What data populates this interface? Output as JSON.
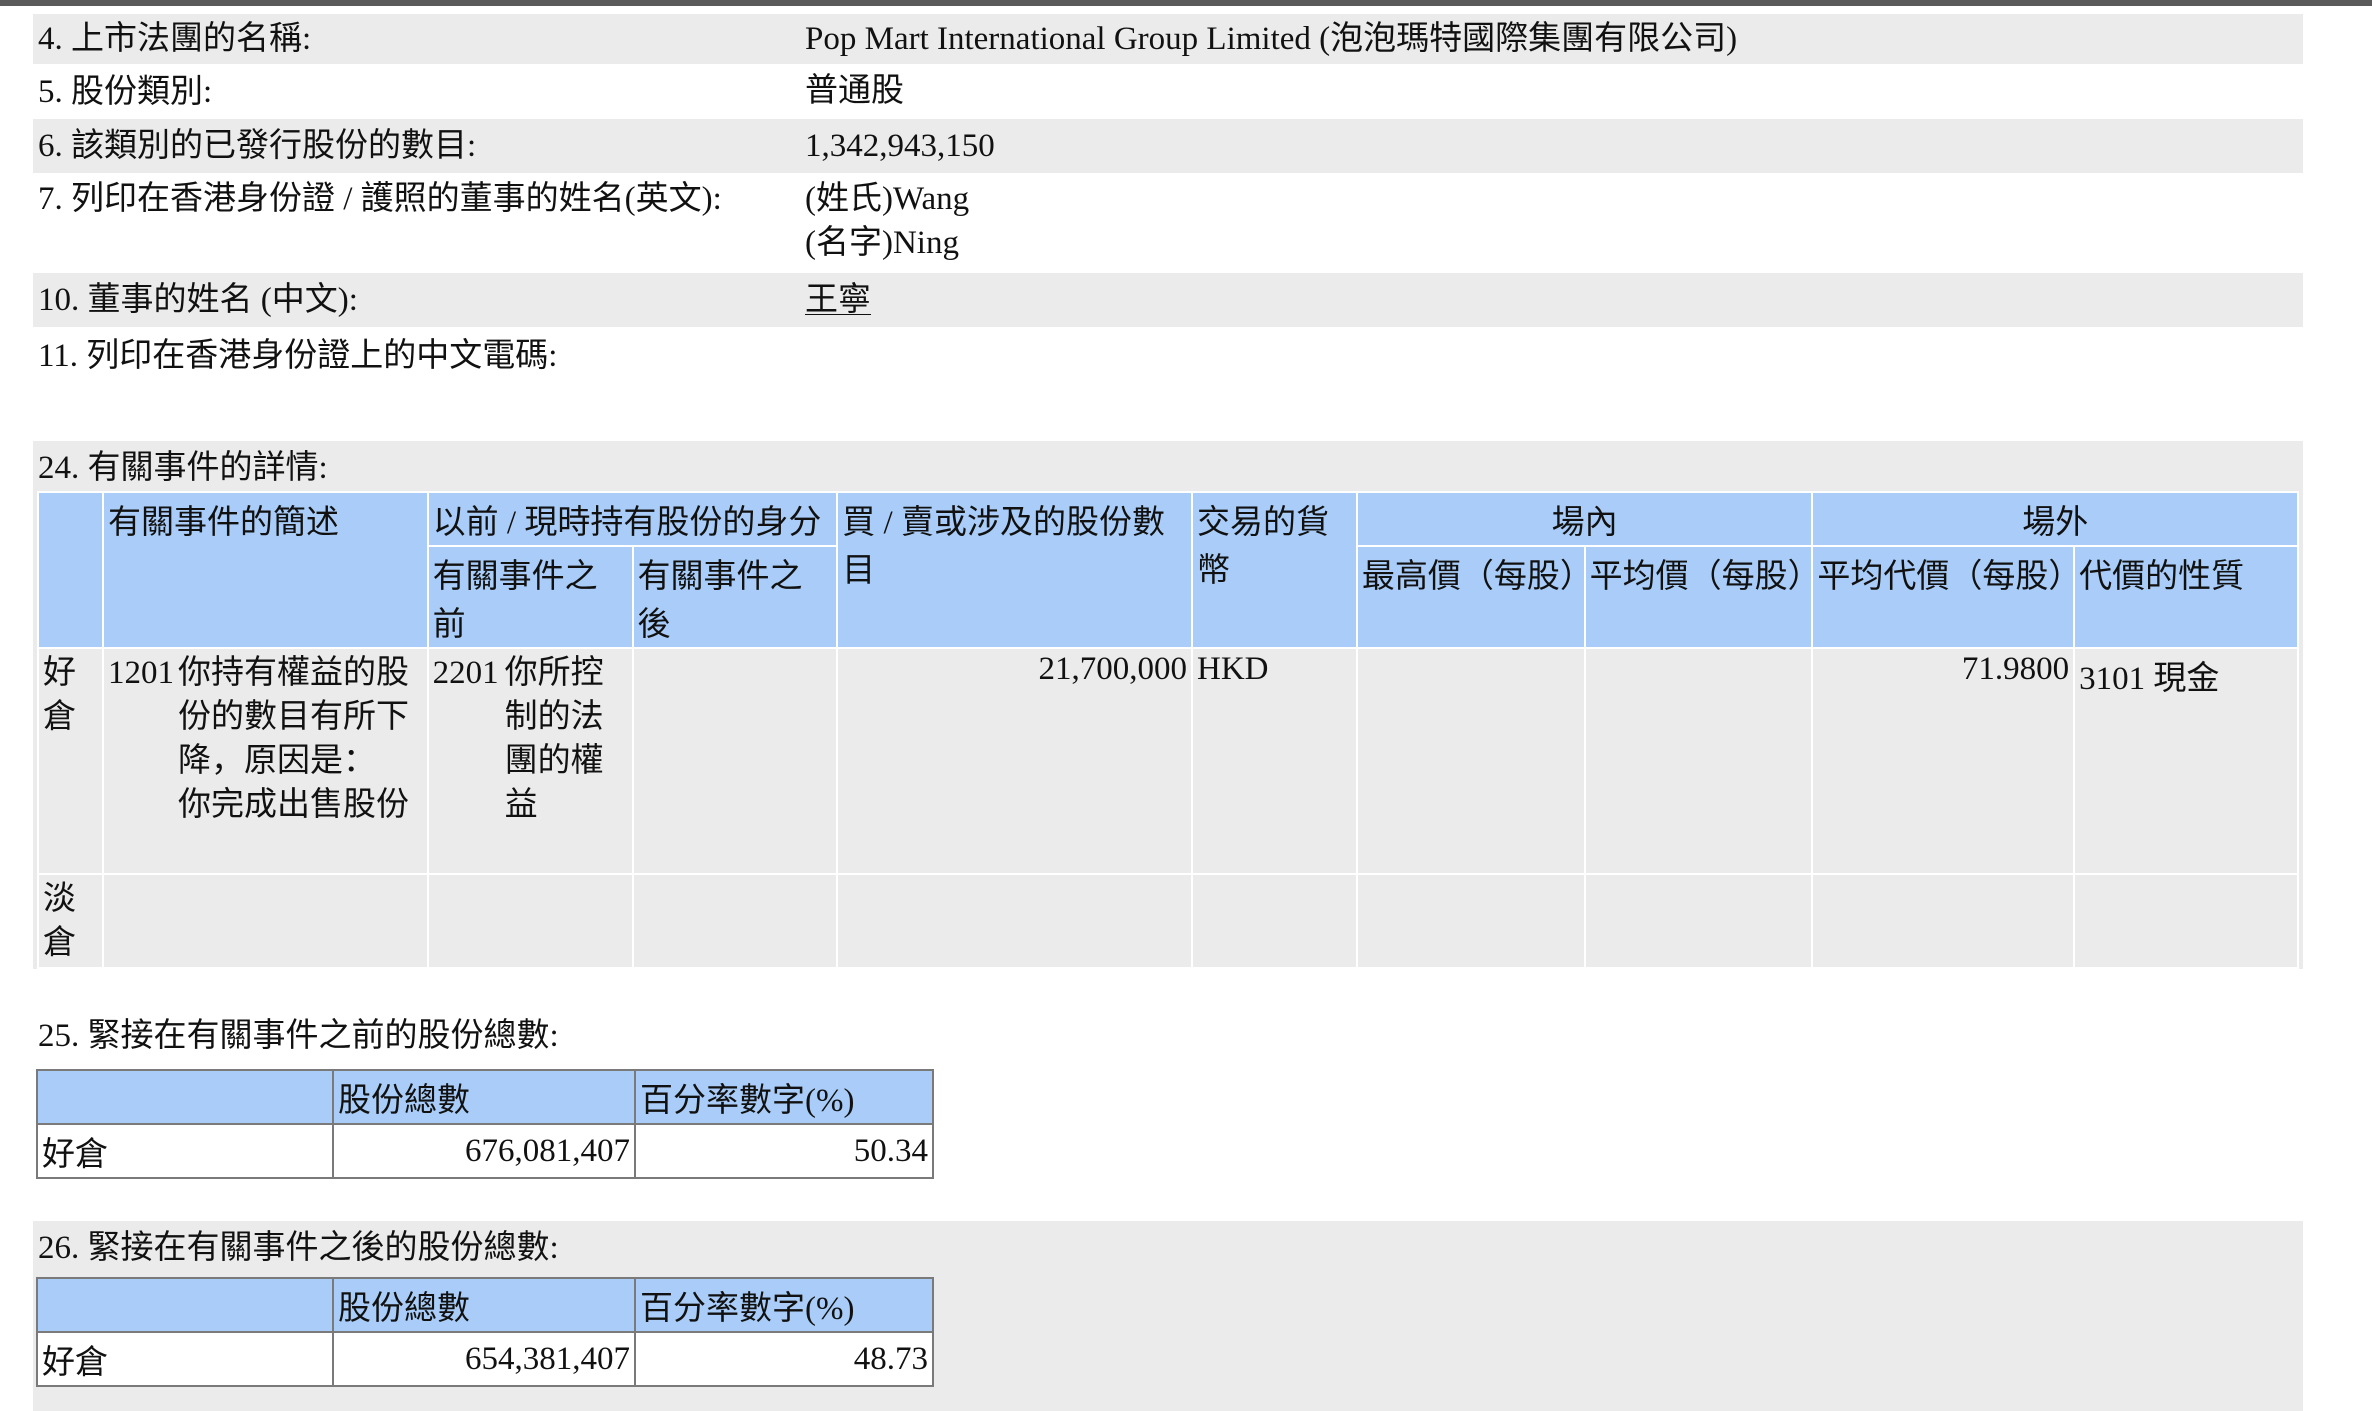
{
  "fields": [
    {
      "label": "4. 上市法團的名稱:",
      "value_lines": [
        "Pop Mart International Group Limited (泡泡瑪特國際集團有限公司)"
      ]
    },
    {
      "label": "5. 股份類別:",
      "value_lines": [
        "普通股"
      ]
    },
    {
      "label": "6. 該類別的已發行股份的數目:",
      "value_lines": [
        "1,342,943,150"
      ]
    },
    {
      "label": "7. 列印在香港身份證 / 護照的董事的姓名(英文):",
      "value_lines": [
        "(姓氏)Wang",
        "(名字)Ning"
      ]
    },
    {
      "label": "10. 董事的姓名 (中文):",
      "value_lines": [
        "王寧"
      ]
    },
    {
      "label": "11. 列印在香港身份證上的中文電碼:",
      "value_lines": []
    }
  ],
  "section24": {
    "title": "24. 有關事件的詳情:",
    "headers": {
      "desc": "有關事件的簡述",
      "capacity": "以前 / 現時持有股份的身分",
      "before": "有關事件之前",
      "after": "有關事件之後",
      "shares": "買 / 賣或涉及的股份數目",
      "currency": "交易的貨幣",
      "onexchange": "場內",
      "high": "最高價（每股）",
      "avg": "平均價（每股）",
      "offexchange": "場外",
      "avgconsid": "平均代價（每股）",
      "nature": "代價的性質"
    },
    "long": {
      "position": "好倉",
      "event_code": "1201",
      "event_desc": "你持有權益的股份的數目有所下降，原因是：你完成出售股份",
      "event_desc_lines": [
        "你持有權益的股",
        "份的數目有所下",
        "降，原因是：",
        "你完成出售股份"
      ],
      "cap_before_code": "2201",
      "cap_before_lines": [
        "你所控",
        "制的法",
        "團的權",
        "益"
      ],
      "shares": "21,700,000",
      "currency": "HKD",
      "avg_consideration": "71.9800",
      "nature_code": "3101",
      "nature": "現金"
    },
    "short": {
      "position": "淡倉"
    }
  },
  "section25": {
    "title": "25. 緊接在有關事件之前的股份總數:",
    "col_total": "股份總數",
    "col_pct": "百分率數字(%)",
    "row_label": "好倉",
    "total": "676,081,407",
    "pct": "50.34"
  },
  "section26": {
    "title": "26. 緊接在有關事件之後的股份總數:",
    "col_total": "股份總數",
    "col_pct": "百分率數字(%)",
    "row_label": "好倉",
    "total": "654,381,407",
    "pct": "48.73"
  },
  "colors": {
    "header_blue": "#a9cdf8",
    "cell_grey": "#ebebeb"
  }
}
